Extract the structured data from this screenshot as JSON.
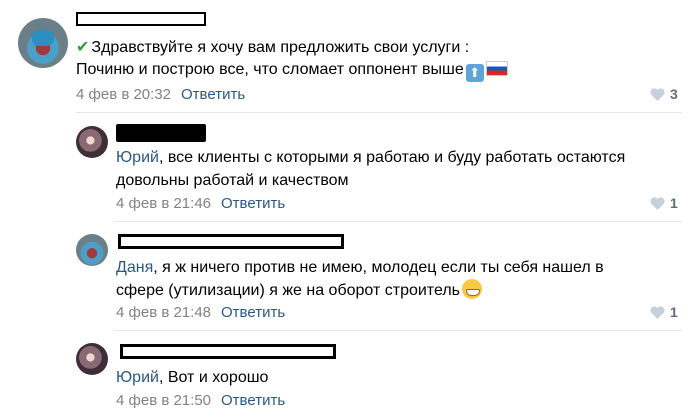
{
  "comments": [
    {
      "lines": [
        "Здравствуйте я хочу вам предложить свои услуги :",
        "Починю и построю все, что сломает оппонент выше"
      ],
      "date": "4 фев в 20:32",
      "reply_label": "Ответить",
      "likes": "3"
    },
    {
      "mention": "Юрий",
      "lines": [
        ", все клиенты с которыми я работаю и буду работать остаются",
        "довольны работай и качеством"
      ],
      "date": "4 фев в 21:46",
      "reply_label": "Ответить",
      "likes": "1"
    },
    {
      "mention": "Даня",
      "lines": [
        ", я ж ничего против не имею, молодец если ты себя нашел в",
        "сфере (утилизации) я же на оборот строитель"
      ],
      "date": "4 фев в 21:48",
      "reply_label": "Ответить",
      "likes": "1"
    },
    {
      "mention": "Юрий",
      "lines": [
        ", Вот и хорошо"
      ],
      "date": "4 фев в 21:50",
      "reply_label": "Ответить",
      "likes": ""
    }
  ],
  "icons": {
    "like": "heart-icon",
    "check": "check-mark-icon",
    "up_arrow": "up-arrow-emoji",
    "flag": "russia-flag-emoji",
    "grin": "grinning-face-emoji"
  },
  "colors": {
    "link": "#2a5885",
    "meta": "#828282",
    "like": "#626d7a"
  }
}
